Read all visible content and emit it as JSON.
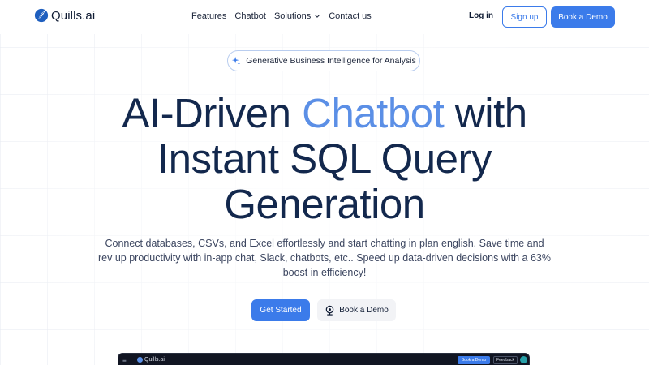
{
  "nav": {
    "logo_text": "Quills.ai",
    "items": [
      {
        "label": "Features"
      },
      {
        "label": "Chatbot"
      },
      {
        "label": "Solutions",
        "dropdown": true
      },
      {
        "label": "Contact us"
      }
    ],
    "login": "Log in",
    "signup": "Sign up",
    "demo": "Book a Demo"
  },
  "badge": {
    "icon": "sparkle-icon",
    "text": "Generative Business Intelligence for Analysis"
  },
  "hero": {
    "line1_a": "AI-Driven ",
    "line1_accent": "Chatbot",
    "line1_b": " with",
    "line2": "Instant SQL Query",
    "line3": "Generation"
  },
  "subtitle": "Connect databases, CSVs, and Excel effortlessly and start chatting in plan english. Save time and rev up productivity with in-app chat, Slack, chatbots, etc.. Speed up data-driven decisions with a 63% boost in efficiency!",
  "cta": {
    "primary": "Get Started",
    "secondary": "Book a Demo",
    "secondary_icon": "webcam-icon"
  },
  "preview": {
    "menu_icon": "≡",
    "logo_text": "Quills.ai",
    "demo": "Book a Demo",
    "feedback": "Feedback"
  },
  "colors": {
    "accent": "#3b7bea",
    "hero_text": "#13284d",
    "hero_accent": "#5b8fe6"
  }
}
